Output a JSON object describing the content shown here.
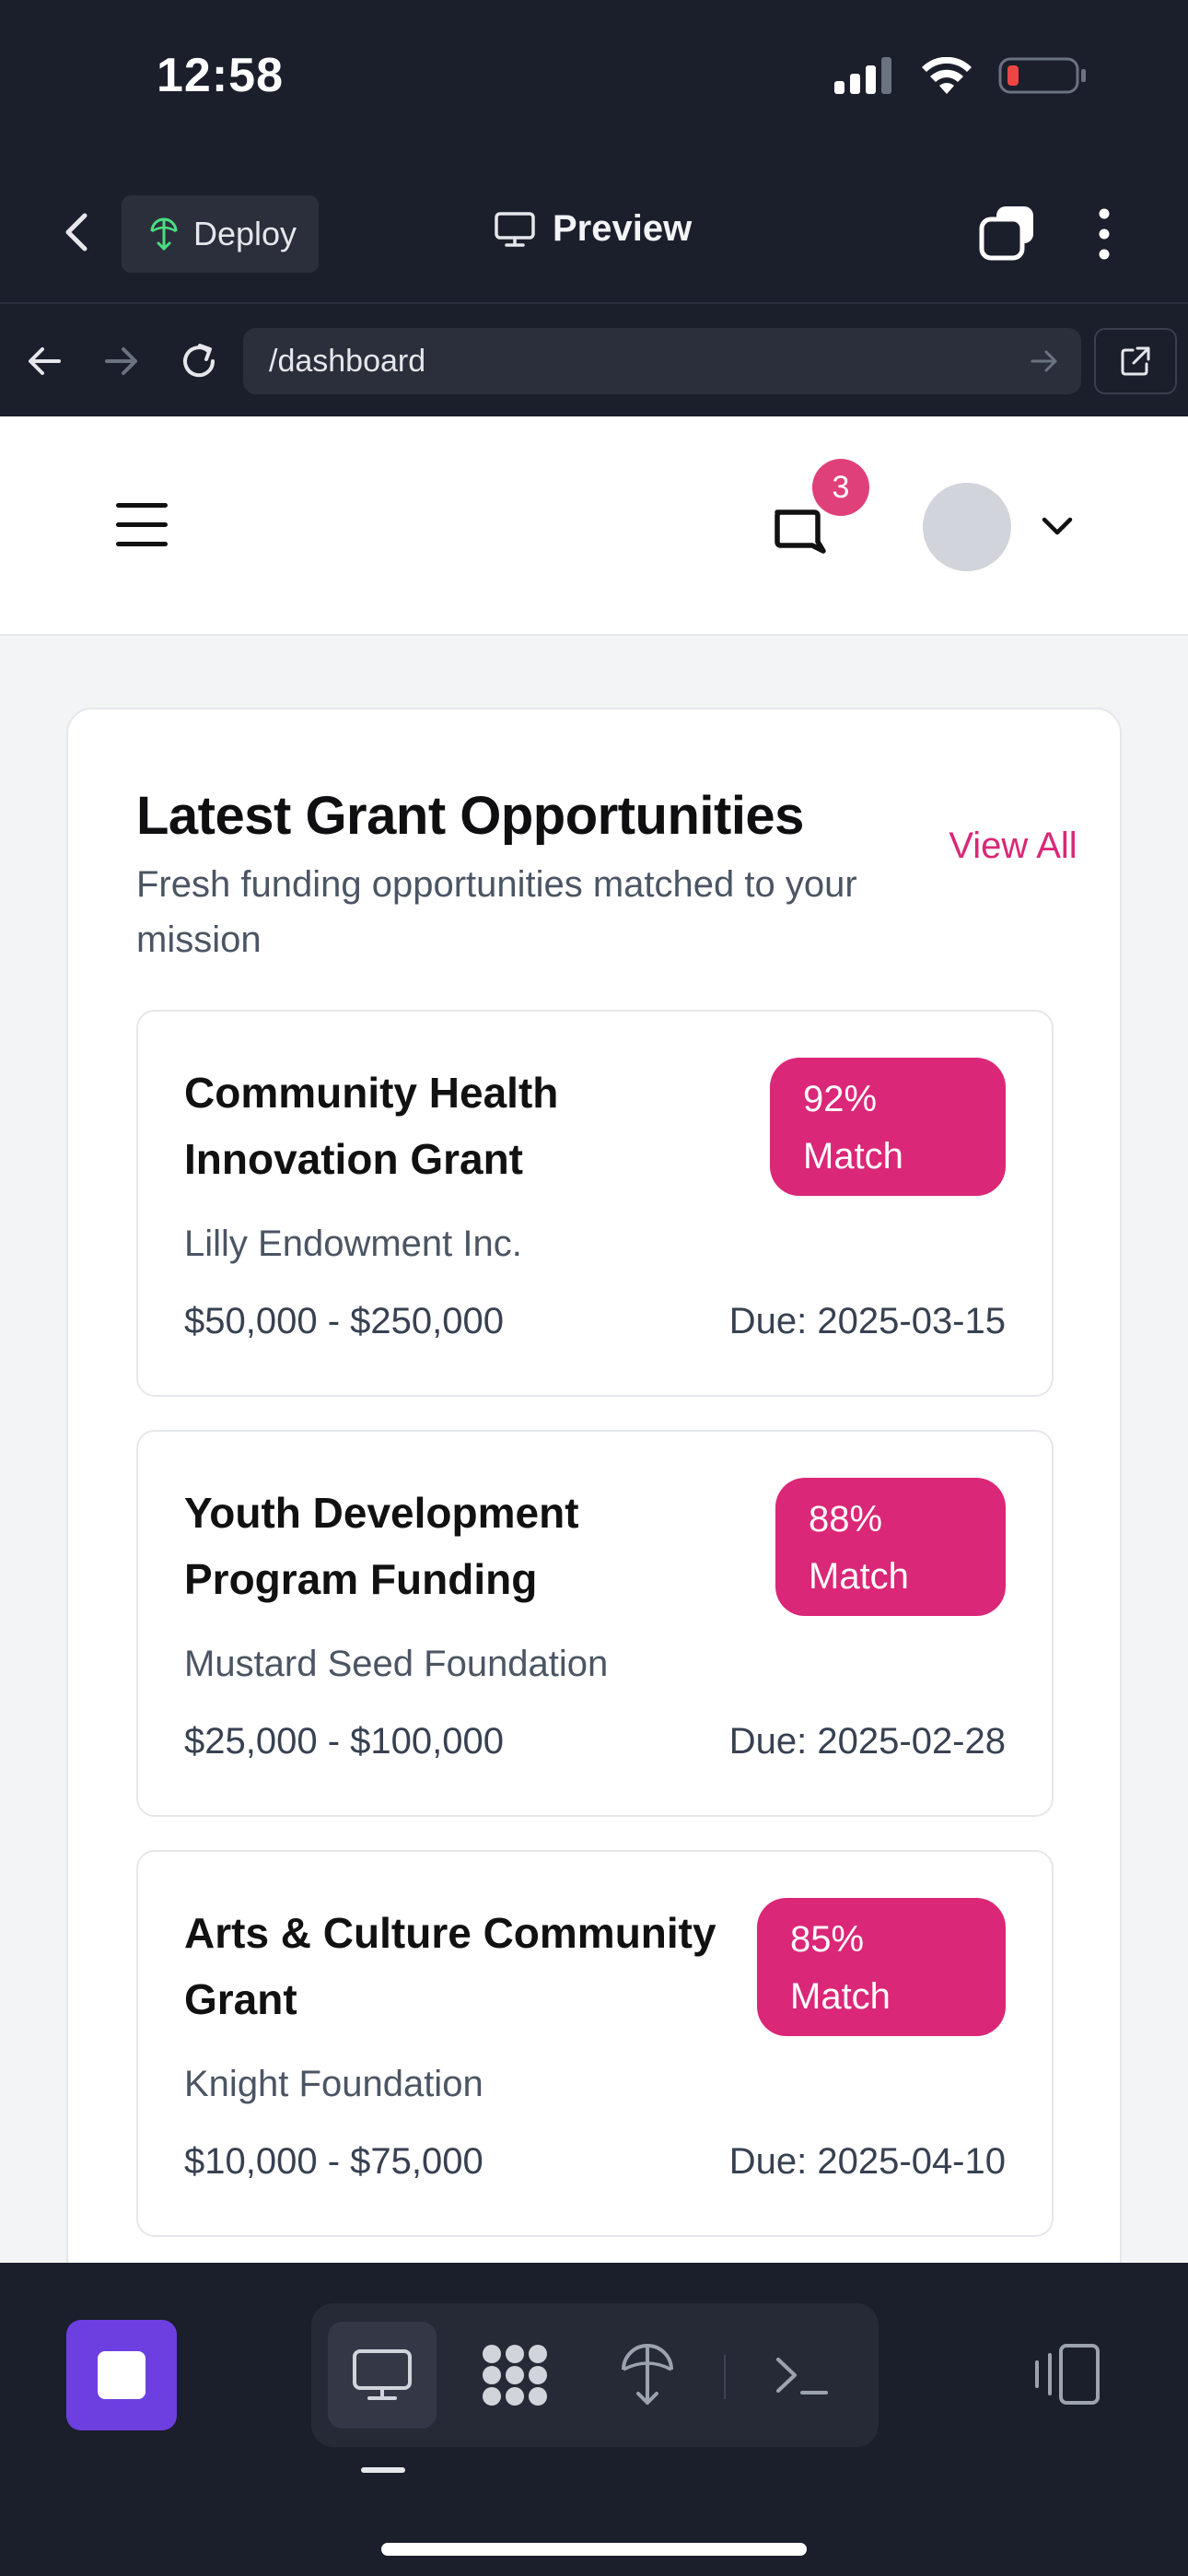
{
  "status_bar": {
    "time": "12:58"
  },
  "app_bar": {
    "deploy_label": "Deploy",
    "title": "Preview"
  },
  "browser": {
    "url": "/dashboard"
  },
  "header": {
    "notification_count": "3"
  },
  "card": {
    "title": "Latest Grant Opportunities",
    "subtitle": "Fresh funding opportunities matched to your mission",
    "view_all_label": "View All",
    "grants": [
      {
        "title": "Community Health Innovation Grant",
        "match": "92% Match",
        "funder": "Lilly Endowment Inc.",
        "amount": "$50,000 - $250,000",
        "due": "Due: 2025-03-15"
      },
      {
        "title": "Youth Development Program Funding",
        "match": "88% Match",
        "funder": "Mustard Seed Foundation",
        "amount": "$25,000 - $100,000",
        "due": "Due: 2025-02-28"
      },
      {
        "title": "Arts & Culture Community Grant",
        "match": "85% Match",
        "funder": "Knight Foundation",
        "amount": "$10,000 - $75,000",
        "due": "Due: 2025-04-10"
      }
    ]
  },
  "toolbar": {
    "modes": [
      "desktop-icon",
      "apps-grid-icon",
      "deploy-icon",
      "terminal-icon"
    ],
    "active_mode": "desktop-icon"
  },
  "colors": {
    "accent": "#db2777",
    "badge": "#e0407a",
    "stop_button": "#6d3fe0",
    "chrome": "#1b1e2b",
    "page_bg": "#f3f4f6"
  }
}
